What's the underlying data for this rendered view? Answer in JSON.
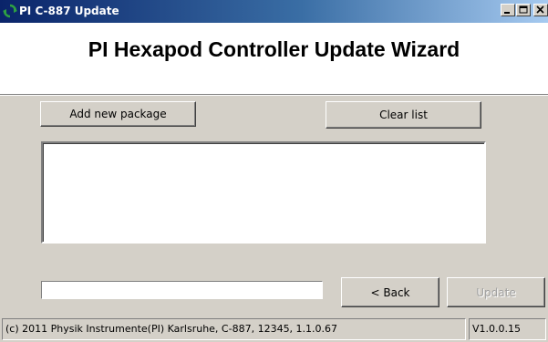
{
  "window": {
    "title": "PI C-887 Update",
    "app_icon": "refresh-arrows-icon",
    "controls": [
      "minimize-icon",
      "maximize-icon",
      "close-icon"
    ]
  },
  "header": {
    "title": "PI Hexapod Controller Update Wizard"
  },
  "buttons": {
    "add_package": "Add new package",
    "clear_list": "Clear list",
    "back": "< Back",
    "update": "Update"
  },
  "package_list": {
    "items": []
  },
  "progress": {
    "value": 0
  },
  "statusbar": {
    "info": "(c) 2011 Physik Instrumente(PI) Karlsruhe, C-887, 12345, 1.1.0.67",
    "version": "V1.0.0.15"
  },
  "colors": {
    "titlebar_start": "#0a246a",
    "titlebar_end": "#a6caf0",
    "face": "#d4d0c8"
  }
}
